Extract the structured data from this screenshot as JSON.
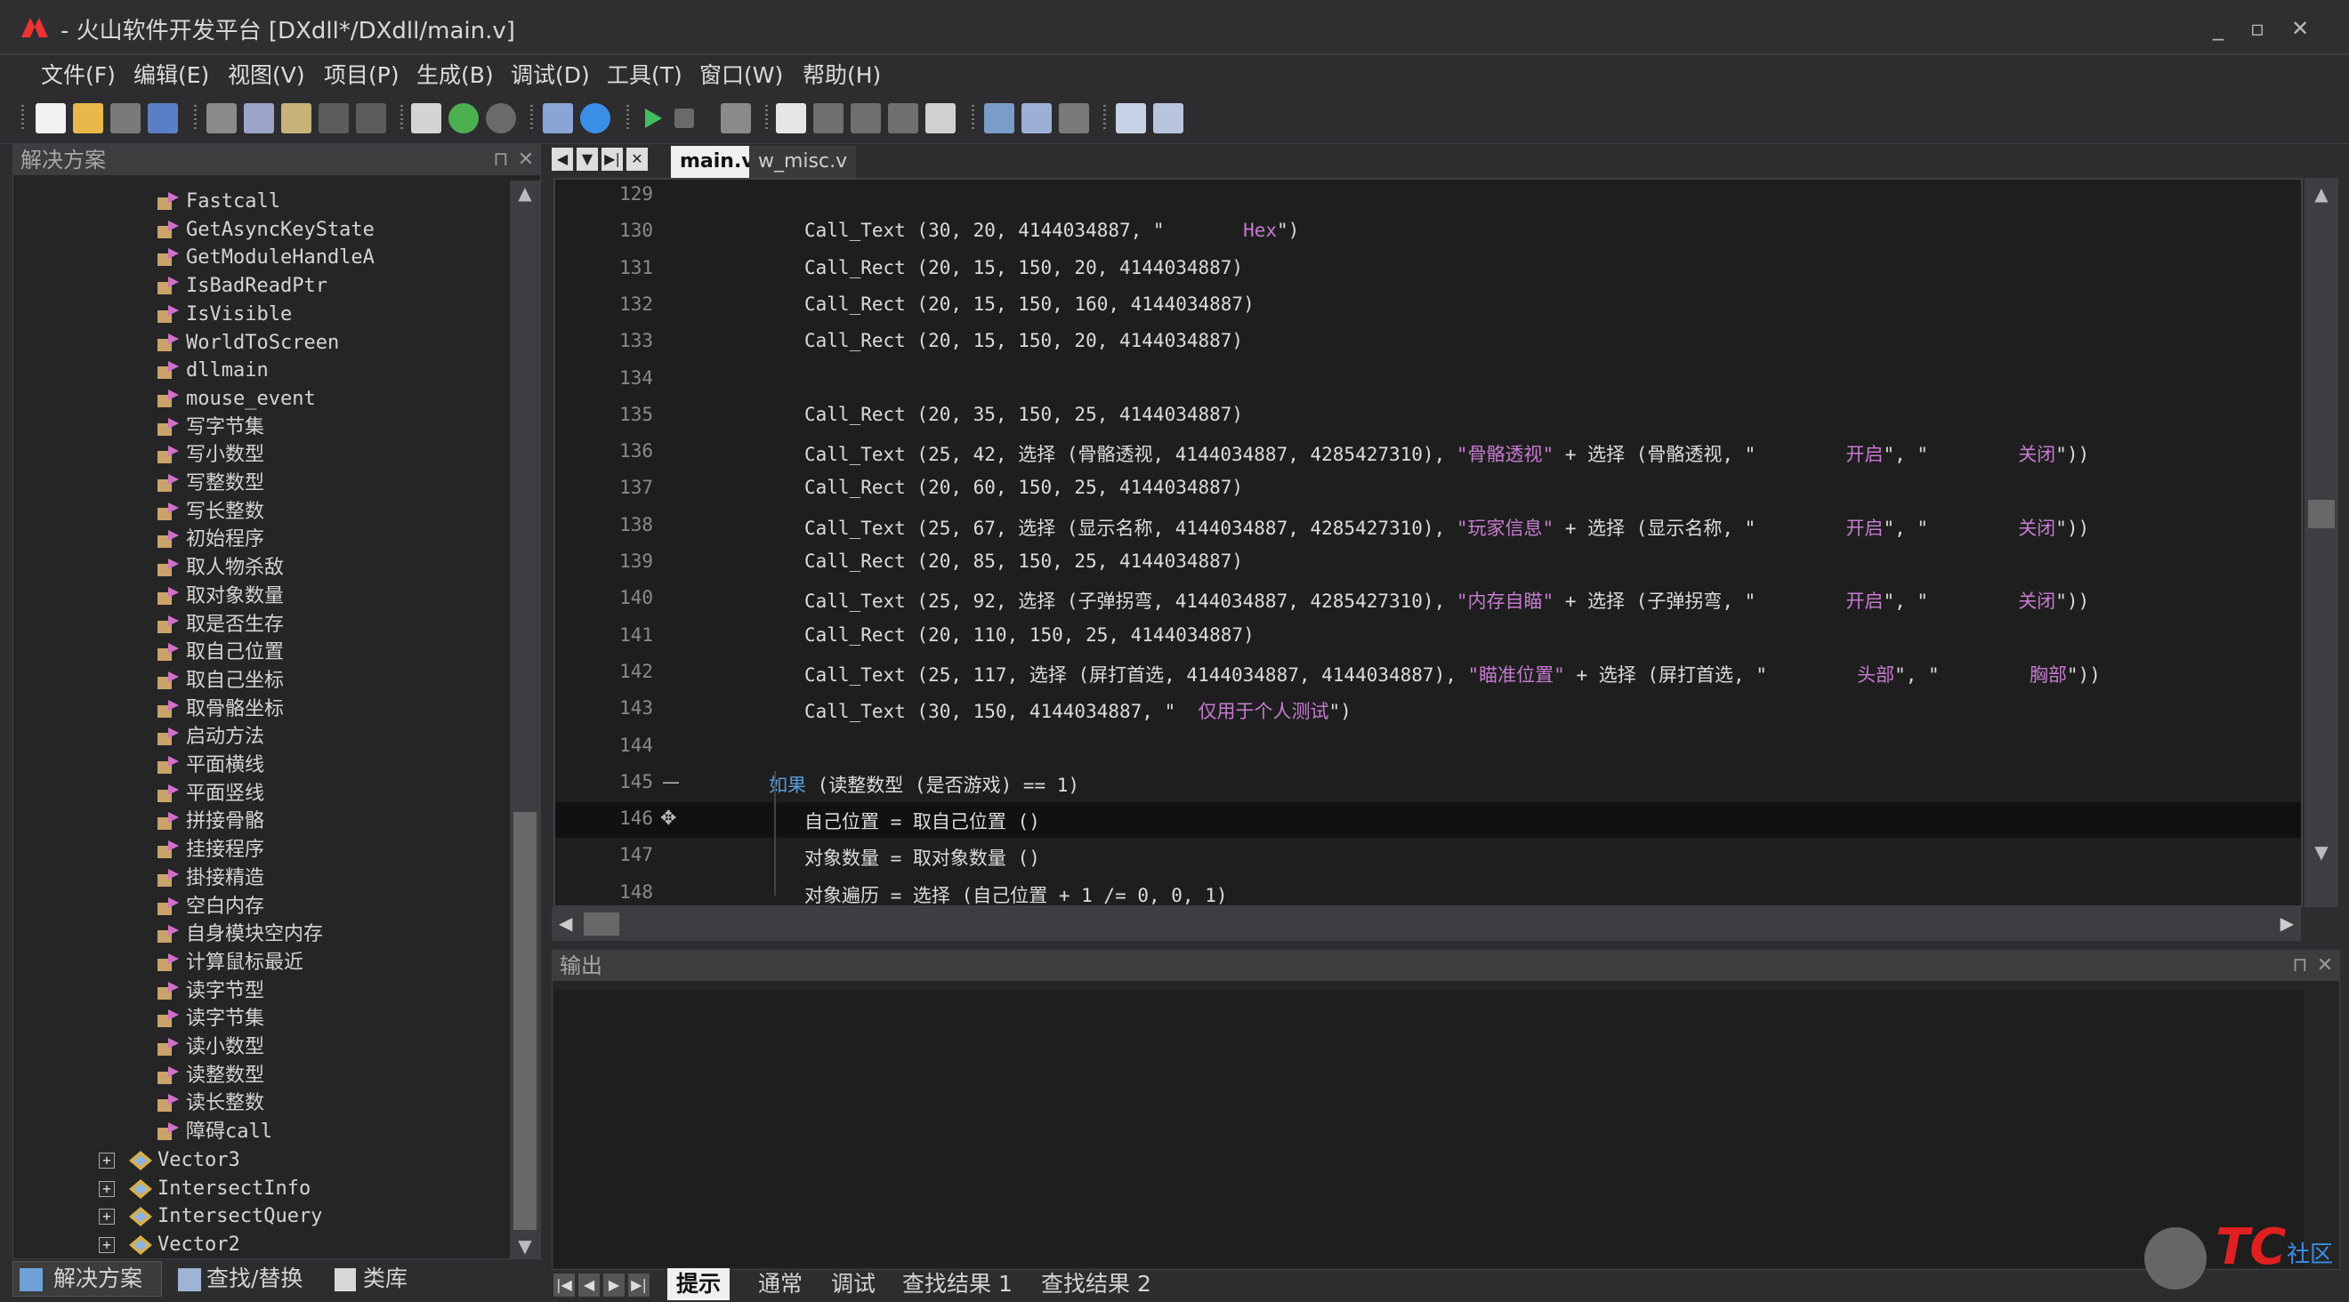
{
  "window": {
    "title": "- 火山软件开发平台 [DXdll*/DXdll/main.v]",
    "controls": [
      "_",
      "▫",
      "✕"
    ]
  },
  "menu": [
    "文件(F)",
    "编辑(E)",
    "视图(V)",
    "项目(P)",
    "生成(B)",
    "调试(D)",
    "工具(T)",
    "窗口(W)",
    "帮助(H)"
  ],
  "solution_pane": {
    "title": "解决方案",
    "pin": "⊓",
    "close": "✕",
    "items": [
      "Fastcall",
      "GetAsyncKeyState",
      "GetModuleHandleA",
      "IsBadReadPtr",
      "IsVisible",
      "WorldToScreen",
      "dllmain",
      "mouse_event",
      "写字节集",
      "写小数型",
      "写整数型",
      "写长整数",
      "初始程序",
      "取人物杀敌",
      "取对象数量",
      "取是否生存",
      "取自己位置",
      "取自己坐标",
      "取骨骼坐标",
      "启动方法",
      "平面横线",
      "平面竖线",
      "拼接骨骼",
      "挂接程序",
      "掛接精造",
      "空白内存",
      "自身模块空内存",
      "计算鼠标最近",
      "读字节型",
      "读字节集",
      "读小数型",
      "读整数型",
      "读长整数",
      "障碍call"
    ],
    "groups": [
      "Vector3",
      "IntersectInfo",
      "IntersectQuery",
      "Vector2"
    ],
    "bottom_tabs": [
      "解决方案",
      "查找/替换",
      "类库"
    ]
  },
  "editor": {
    "nav_buttons": [
      "◀",
      "▼",
      "▶|",
      "✕"
    ],
    "tabs": [
      "main.v",
      "w_misc.v"
    ],
    "active_tab": "main.v",
    "lines": [
      {
        "n": "129",
        "code": []
      },
      {
        "n": "130",
        "code": [
          {
            "t": "Call_Text (30, 20, 4144034887, \""
          },
          {
            "t": "       Hex",
            "c": "str"
          },
          {
            "t": "\")"
          }
        ]
      },
      {
        "n": "131",
        "code": [
          {
            "t": "Call_Rect (20, 15, 150, 20, 4144034887)"
          }
        ]
      },
      {
        "n": "132",
        "code": [
          {
            "t": "Call_Rect (20, 15, 150, 160, 4144034887)"
          }
        ]
      },
      {
        "n": "133",
        "code": [
          {
            "t": "Call_Rect (20, 15, 150, 20, 4144034887)"
          }
        ]
      },
      {
        "n": "134",
        "code": []
      },
      {
        "n": "135",
        "code": [
          {
            "t": "Call_Rect (20, 35, 150, 25, 4144034887)"
          }
        ]
      },
      {
        "n": "136",
        "code": [
          {
            "t": "Call_Text (25, 42, 选择 (骨骼透视, 4144034887, 4285427310), "
          },
          {
            "t": "\"骨骼透视\"",
            "c": "str"
          },
          {
            "t": " + 选择 (骨骼透视, \"        "
          },
          {
            "t": "开启",
            "c": "str"
          },
          {
            "t": "\", \"        "
          },
          {
            "t": "关闭",
            "c": "str"
          },
          {
            "t": "\"))"
          }
        ]
      },
      {
        "n": "137",
        "code": [
          {
            "t": "Call_Rect (20, 60, 150, 25, 4144034887)"
          }
        ]
      },
      {
        "n": "138",
        "code": [
          {
            "t": "Call_Text (25, 67, 选择 (显示名称, 4144034887, 4285427310), "
          },
          {
            "t": "\"玩家信息\"",
            "c": "str"
          },
          {
            "t": " + 选择 (显示名称, \"        "
          },
          {
            "t": "开启",
            "c": "str"
          },
          {
            "t": "\", \"        "
          },
          {
            "t": "关闭",
            "c": "str"
          },
          {
            "t": "\"))"
          }
        ]
      },
      {
        "n": "139",
        "code": [
          {
            "t": "Call_Rect (20, 85, 150, 25, 4144034887)"
          }
        ]
      },
      {
        "n": "140",
        "code": [
          {
            "t": "Call_Text (25, 92, 选择 (子弹拐弯, 4144034887, 4285427310), "
          },
          {
            "t": "\"内存自瞄\"",
            "c": "str"
          },
          {
            "t": " + 选择 (子弹拐弯, \"        "
          },
          {
            "t": "开启",
            "c": "str"
          },
          {
            "t": "\", \"        "
          },
          {
            "t": "关闭",
            "c": "str"
          },
          {
            "t": "\"))"
          }
        ]
      },
      {
        "n": "141",
        "code": [
          {
            "t": "Call_Rect (20, 110, 150, 25, 4144034887)"
          }
        ]
      },
      {
        "n": "142",
        "code": [
          {
            "t": "Call_Text (25, 117, 选择 (屏打首选, 4144034887, 4144034887), "
          },
          {
            "t": "\"瞄准位置\"",
            "c": "str"
          },
          {
            "t": " + 选择 (屏打首选, \"        "
          },
          {
            "t": "头部",
            "c": "str"
          },
          {
            "t": "\", \"        "
          },
          {
            "t": "胸部",
            "c": "str"
          },
          {
            "t": "\"))"
          }
        ]
      },
      {
        "n": "143",
        "code": [
          {
            "t": "Call_Text (30, 150, 4144034887, \"  "
          },
          {
            "t": "仅用于个人测试",
            "c": "str"
          },
          {
            "t": "\")"
          }
        ]
      },
      {
        "n": "144",
        "code": []
      },
      {
        "n": "145",
        "code": [
          {
            "t": "如果",
            "c": "kw"
          },
          {
            "t": " (读整数型 (是否游戏) == 1)"
          }
        ],
        "indent": "outer",
        "fold": "—"
      },
      {
        "n": "146",
        "code": [
          {
            "t": "自己位置 = 取自己位置 ()"
          }
        ],
        "current": true
      },
      {
        "n": "147",
        "code": [
          {
            "t": "对象数量 = 取对象数量 ()"
          }
        ]
      },
      {
        "n": "148",
        "code": [
          {
            "t": "对象遍历 = 选择 (自己位置 + 1 /= 0, 0, 1)"
          }
        ]
      }
    ]
  },
  "output_pane": {
    "title": "输出",
    "tabs": [
      "提示",
      "通常",
      "调试",
      "查找结果 1",
      "查找结果 2"
    ],
    "active_tab": "提示"
  },
  "watermark": {
    "text": "TC",
    "sub": "社区"
  }
}
